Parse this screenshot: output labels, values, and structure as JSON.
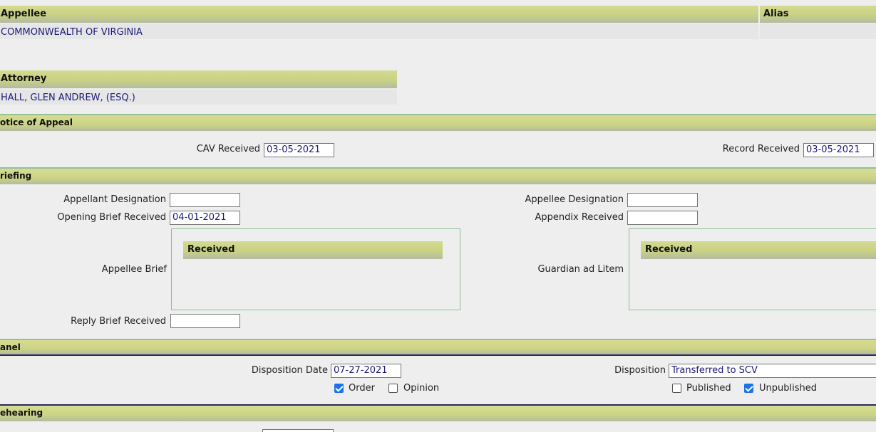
{
  "appellee_section": {
    "appellee_header": "Appellee",
    "alias_header": "Alias",
    "appellee_name": "COMMONWEALTH OF VIRGINIA"
  },
  "attorney_section": {
    "header": "Attorney",
    "name": "HALL, GLEN ANDREW, (ESQ.)"
  },
  "notice_of_appeal": {
    "header": "otice of Appeal",
    "cav_received_label": "CAV Received",
    "cav_received_value": "03-05-2021",
    "record_received_label": "Record Received",
    "record_received_value": "03-05-2021"
  },
  "briefing": {
    "header": "riefing",
    "appellant_designation_label": "Appellant Designation",
    "appellant_designation_value": "",
    "opening_brief_label": "Opening Brief Received",
    "opening_brief_value": "04-01-2021",
    "appellee_designation_label": "Appellee Designation",
    "appellee_designation_value": "",
    "appendix_received_label": "Appendix Received",
    "appendix_received_value": "",
    "appellee_brief_label": "Appellee Brief",
    "appellee_brief_table_header": "Received",
    "guardian_label": "Guardian ad Litem",
    "guardian_table_header": "Received",
    "reply_brief_label": "Reply Brief Received",
    "reply_brief_value": ""
  },
  "panel": {
    "header": "anel",
    "disposition_date_label": "Disposition Date",
    "disposition_date_value": "07-27-2021",
    "disposition_label": "Disposition",
    "disposition_value": "Transferred to SCV",
    "order_label": "Order",
    "order_checked": true,
    "opinion_label": "Opinion",
    "opinion_checked": false,
    "published_label": "Published",
    "published_checked": false,
    "unpublished_label": "Unpublished",
    "unpublished_checked": true
  },
  "rehearing": {
    "header": "ehearing"
  },
  "colors": {
    "header_olive": "#ccd385",
    "link_navy": "#1a1a7a",
    "checkbox_blue": "#1a73e8",
    "section_rule_green": "#95c195"
  }
}
